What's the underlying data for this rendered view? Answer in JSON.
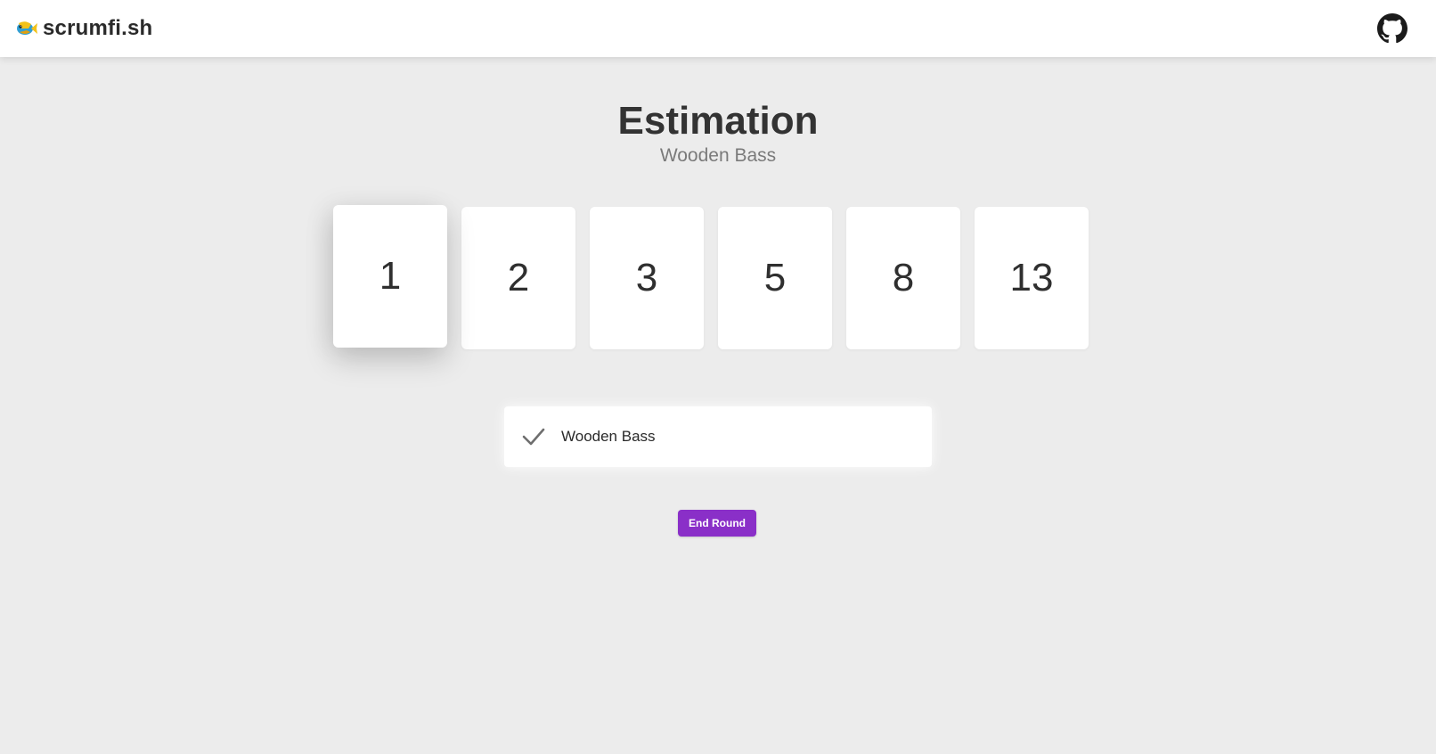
{
  "header": {
    "brand": "scrumfi.sh",
    "brand_icon": "fish-icon",
    "github_icon": "github-icon"
  },
  "main": {
    "title": "Estimation",
    "subtitle": "Wooden Bass"
  },
  "cards": [
    {
      "label": "1",
      "selected": true
    },
    {
      "label": "2",
      "selected": false
    },
    {
      "label": "3",
      "selected": false
    },
    {
      "label": "5",
      "selected": false
    },
    {
      "label": "8",
      "selected": false
    },
    {
      "label": "13",
      "selected": false
    }
  ],
  "votes": [
    {
      "name": "Wooden Bass",
      "status_icon": "checkmark-icon",
      "voted": true
    }
  ],
  "actions": {
    "end_round_label": "End Round"
  },
  "colors": {
    "accent": "#8a2fc8",
    "background": "#ececec",
    "surface": "#ffffff"
  }
}
